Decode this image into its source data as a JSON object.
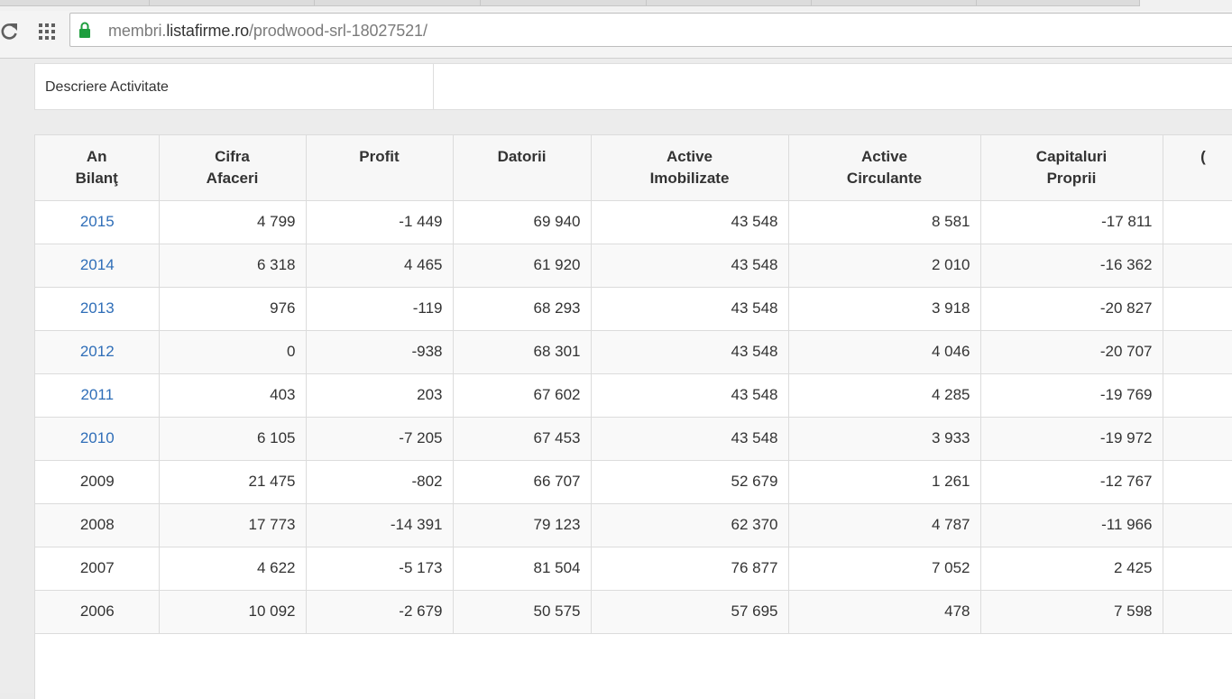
{
  "browser": {
    "url_prefix": "membri.",
    "url_domain": "listafirme.ro",
    "url_path": "/prodwood-srl-18027521/"
  },
  "description": {
    "label": "Descriere Activitate"
  },
  "table": {
    "headers": [
      [
        "An",
        "Bilanţ"
      ],
      [
        "Cifra",
        "Afaceri"
      ],
      [
        "Profit",
        ""
      ],
      [
        "Datorii",
        ""
      ],
      [
        "Active",
        "Imobilizate"
      ],
      [
        "Active",
        "Circulante"
      ],
      [
        "Capitaluri",
        "Proprii"
      ],
      [
        "",
        "("
      ]
    ],
    "rows": [
      {
        "year": "2015",
        "link": true,
        "values": [
          "4 799",
          "-1 449",
          "69 940",
          "43 548",
          "8 581",
          "-17 811",
          ""
        ]
      },
      {
        "year": "2014",
        "link": true,
        "values": [
          "6 318",
          "4 465",
          "61 920",
          "43 548",
          "2 010",
          "-16 362",
          ""
        ]
      },
      {
        "year": "2013",
        "link": true,
        "values": [
          "976",
          "-119",
          "68 293",
          "43 548",
          "3 918",
          "-20 827",
          ""
        ]
      },
      {
        "year": "2012",
        "link": true,
        "values": [
          "0",
          "-938",
          "68 301",
          "43 548",
          "4 046",
          "-20 707",
          ""
        ]
      },
      {
        "year": "2011",
        "link": true,
        "values": [
          "403",
          "203",
          "67 602",
          "43 548",
          "4 285",
          "-19 769",
          ""
        ]
      },
      {
        "year": "2010",
        "link": true,
        "values": [
          "6 105",
          "-7 205",
          "67 453",
          "43 548",
          "3 933",
          "-19 972",
          ""
        ]
      },
      {
        "year": "2009",
        "link": false,
        "values": [
          "21 475",
          "-802",
          "66 707",
          "52 679",
          "1 261",
          "-12 767",
          ""
        ]
      },
      {
        "year": "2008",
        "link": false,
        "values": [
          "17 773",
          "-14 391",
          "79 123",
          "62 370",
          "4 787",
          "-11 966",
          ""
        ]
      },
      {
        "year": "2007",
        "link": false,
        "values": [
          "4 622",
          "-5 173",
          "81 504",
          "76 877",
          "7 052",
          "2 425",
          ""
        ]
      },
      {
        "year": "2006",
        "link": false,
        "values": [
          "10 092",
          "-2 679",
          "50 575",
          "57 695",
          "478",
          "7 598",
          ""
        ]
      }
    ]
  }
}
